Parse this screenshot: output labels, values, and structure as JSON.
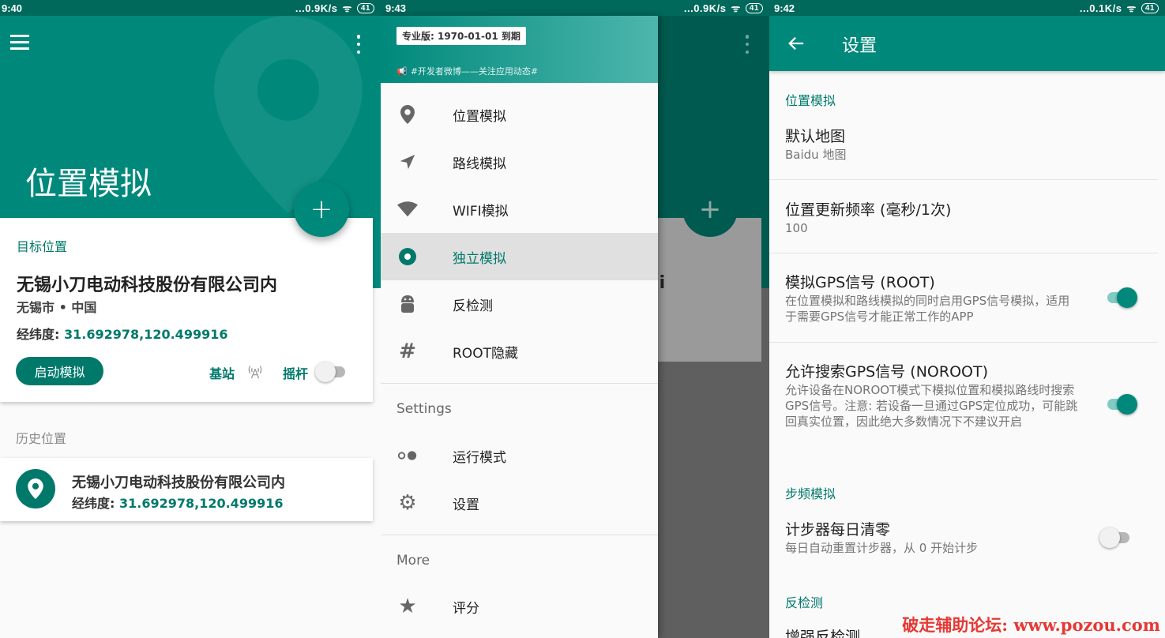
{
  "panel1": {
    "status": {
      "time": "9:40",
      "speed": "...0.9K/s",
      "battery": "41"
    },
    "title": "位置模拟",
    "fab": "+",
    "target": {
      "label": "目标位置",
      "name": "无锡小刀电动科技股份有限公司内",
      "city": "无锡市 • 中国",
      "coord_label": "经纬度:",
      "coord_value": "31.692978,120.499916",
      "start_button": "启动模拟",
      "station_label": "基站",
      "joystick_label": "摇杆",
      "joystick_on": false
    },
    "history": {
      "label": "历史位置",
      "items": [
        {
          "name": "无锡小刀电动科技股份有限公司内",
          "coord_label": "经纬度:",
          "coord_value": "31.692978,120.499916"
        }
      ]
    }
  },
  "panel2": {
    "status": {
      "time": "9:43",
      "speed": "...0.9K/s",
      "battery": "41"
    },
    "pro_badge": "专业版: 1970-01-01 到期",
    "dev_line": "#开发者微博——关注应用动态#",
    "background_card_text": "iFi",
    "menu": [
      {
        "label": "位置模拟",
        "icon": "location-pin-icon"
      },
      {
        "label": "路线模拟",
        "icon": "navigation-arrow-icon"
      },
      {
        "label": "WIFI模拟",
        "icon": "wifi-icon"
      },
      {
        "label": "独立模拟",
        "icon": "radio-target-icon",
        "active": true
      },
      {
        "label": "反检测",
        "icon": "android-icon"
      },
      {
        "label": "ROOT隐藏",
        "icon": "hash-icon"
      }
    ],
    "settings_header": "Settings",
    "settings_menu": [
      {
        "label": "运行模式",
        "icon": "toggle-dots-icon"
      },
      {
        "label": "设置",
        "icon": "gear-icon"
      }
    ],
    "more_header": "More",
    "more_menu": [
      {
        "label": "评分",
        "icon": "star-icon"
      }
    ]
  },
  "panel3": {
    "status": {
      "time": "9:42",
      "speed": "...0.1K/s",
      "battery": "41"
    },
    "title": "设置",
    "categories": {
      "location": "位置模拟",
      "steps": "步频模拟",
      "anti": "反检测"
    },
    "items": {
      "default_map": {
        "title": "默认地图",
        "summary": "Baidu 地图"
      },
      "update_freq": {
        "title": "位置更新频率 (毫秒/1次)",
        "summary": "100"
      },
      "gps_root": {
        "title": "模拟GPS信号 (ROOT)",
        "summary": "在位置模拟和路线模拟的同时启用GPS信号模拟，适用于需要GPS信号才能正常工作的APP",
        "on": true
      },
      "gps_noroot": {
        "title": "允许搜索GPS信号 (NOROOT)",
        "summary": "允许设备在NOROOT模式下模拟位置和模拟路线时搜索GPS信号。注意: 若设备一旦通过GPS定位成功，可能跳回真实位置，因此绝大多数情况下不建议开启",
        "on": true
      },
      "step_reset": {
        "title": "计步器每日清零",
        "summary": "每日自动重置计步器，从 0 开始计步",
        "on": false
      },
      "enhanced_anti": {
        "title": "增强反检测"
      }
    }
  },
  "watermark": "破走辅助论坛: www.pozou.com",
  "colors": {
    "primary": "#00897b",
    "primary_dark": "#00796b",
    "accent_light": "#80cbc4"
  }
}
